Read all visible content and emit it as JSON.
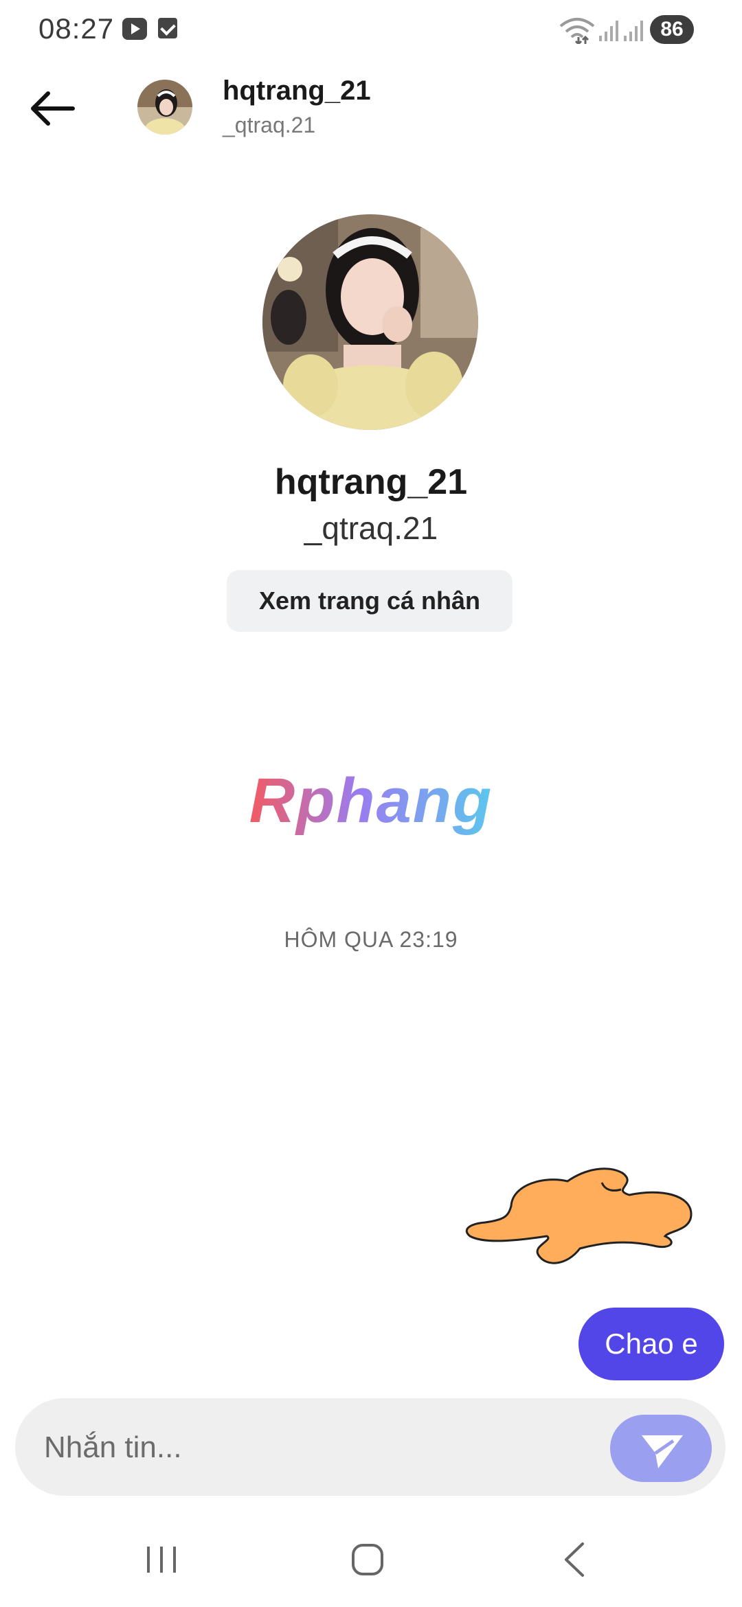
{
  "status_bar": {
    "time": "08:27",
    "battery": "86",
    "icons": [
      "youtube-icon",
      "task-check-icon",
      "wifi-icon",
      "signal-icon",
      "signal-icon"
    ]
  },
  "header": {
    "back_icon": "back-arrow-icon",
    "name": "hqtrang_21",
    "handle": "_qtraq.21"
  },
  "profile": {
    "name": "hqtrang_21",
    "handle": "_qtraq.21",
    "view_profile_label": "Xem trang cá nhân"
  },
  "watermark": "Rphang",
  "conversation": {
    "date_divider": "HÔM QUA 23:19",
    "messages": [
      {
        "from": "me",
        "type": "sticker"
      },
      {
        "from": "me",
        "type": "text",
        "text": "Chao e"
      }
    ]
  },
  "composer": {
    "placeholder": "Nhắn tin..."
  },
  "nav": {
    "icons": [
      "recents-icon",
      "home-icon",
      "back-icon"
    ]
  },
  "colors": {
    "accent": "#5346e8",
    "send_button": "#9a9ff0",
    "sticker": "#ffad5a"
  }
}
